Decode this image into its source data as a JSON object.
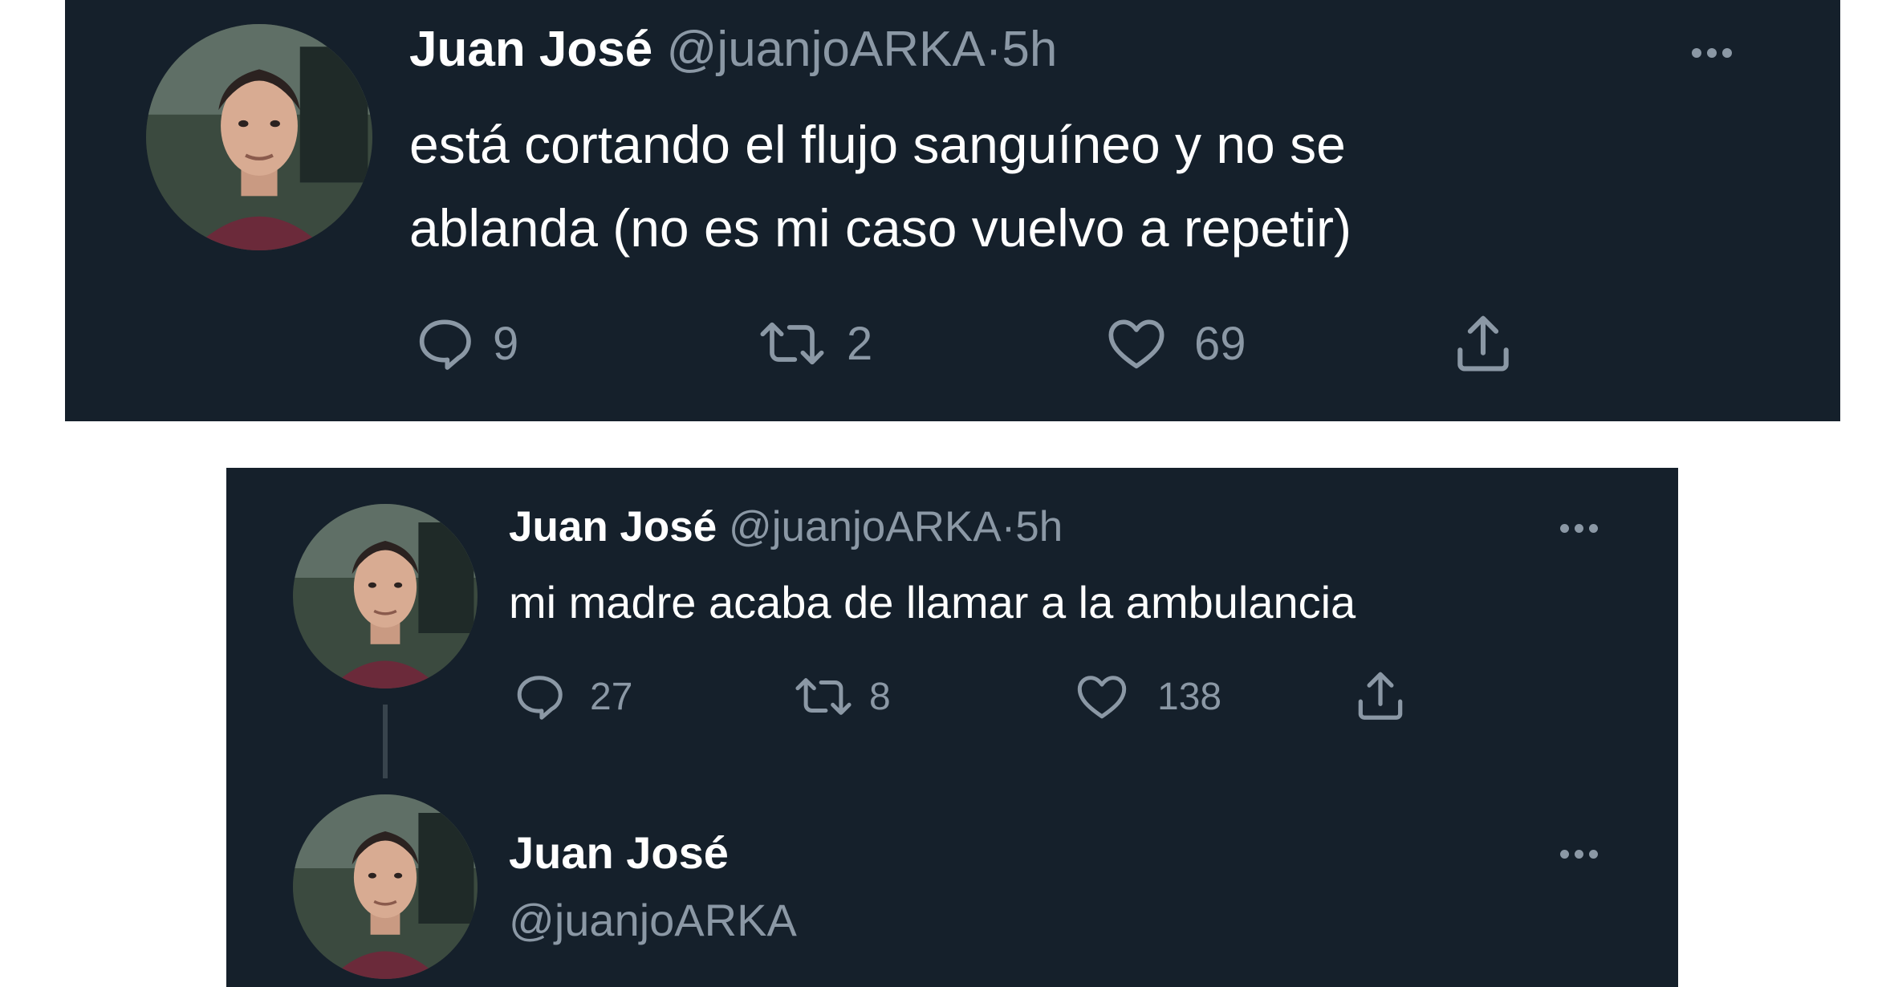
{
  "tweets": [
    {
      "name": "Juan José",
      "handle": "@juanjoARKA",
      "separator": "·",
      "time": "5h",
      "text_lines": [
        "está cortando el flujo sanguíneo y no se",
        "ablanda (no es mi caso vuelvo a repetir)"
      ],
      "replies": "9",
      "retweets": "2",
      "likes": "69"
    },
    {
      "name": "Juan José",
      "handle": "@juanjoARKA",
      "separator": "·",
      "time": "5h",
      "text_lines": [
        "mi madre acaba de llamar a la ambulancia"
      ],
      "replies": "27",
      "retweets": "8",
      "likes": "138"
    },
    {
      "name": "Juan José",
      "handle": "@juanjoARKA"
    }
  ],
  "icons": {
    "reply": "reply-icon",
    "retweet": "retweet-icon",
    "like": "heart-icon",
    "share": "share-icon",
    "more": "more-icon"
  },
  "colors": {
    "panel_background": "#15202b",
    "primary_text": "#ffffff",
    "secondary_text": "#8b98a5"
  }
}
